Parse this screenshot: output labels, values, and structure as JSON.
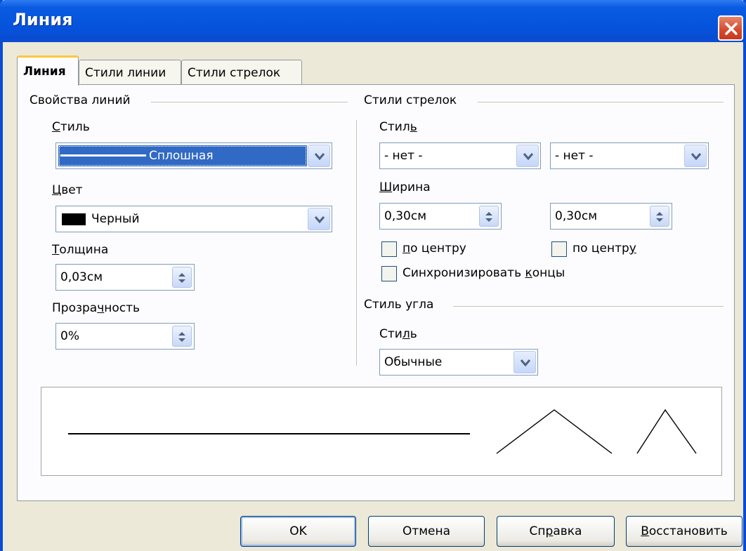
{
  "window": {
    "title": "Линия"
  },
  "tabs": [
    {
      "label": "Линия"
    },
    {
      "label": "Стили линии"
    },
    {
      "label": "Стили стрелок"
    }
  ],
  "line_props": {
    "group_label": "Свойства линий",
    "style_label": "Стиль",
    "style_value": "Сплошная",
    "color_label": "Цвет",
    "color_value": "Черный",
    "color_swatch": "#000000",
    "width_label": "Толщина",
    "width_value": "0,03см",
    "transparency_label": "Прозрачность",
    "transparency_value": "0%"
  },
  "arrow_styles": {
    "group_label": "Стили стрелок",
    "style_label": "Стиль",
    "start_style": "- нет -",
    "end_style": "- нет -",
    "width_label": "Ширина",
    "start_width": "0,30см",
    "end_width": "0,30см",
    "start_center_label": "по центру",
    "end_center_label": "по центру",
    "sync_label": "Синхронизировать концы"
  },
  "corner_style": {
    "group_label": "Стиль угла",
    "style_label": "Стиль",
    "style_value": "Обычные"
  },
  "buttons": {
    "ok": "OK",
    "cancel": "Отмена",
    "help": "Справка",
    "reset": "Восстановить"
  },
  "colors": {
    "title_bar": "#0554dc",
    "selection": "#316ac5",
    "active_tab_accent": "#ffc83c"
  },
  "icons": {
    "close": "close-icon",
    "dropdown": "chevron-down-icon",
    "spin": "spin-updown-icon"
  }
}
